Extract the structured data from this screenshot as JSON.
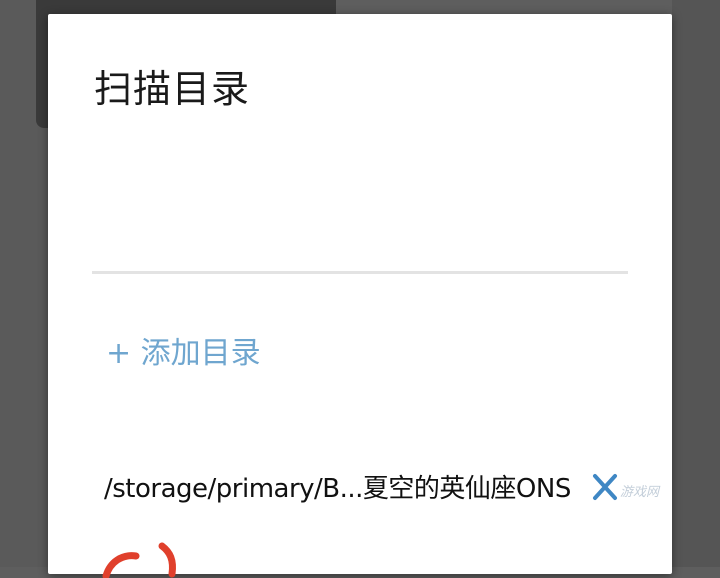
{
  "dialog": {
    "title": "扫描目录",
    "add_directory_label": "+ 添加目录",
    "directories": [
      {
        "path": "/storage/primary/B...夏空的英仙座ONS"
      }
    ]
  },
  "icons": {
    "remove": "close-x-icon"
  },
  "watermark": {
    "text": "游戏网"
  },
  "colors": {
    "accent": "#6fa6cf",
    "remove_icon": "#3f87c4",
    "title_text": "#1a1a1a",
    "divider": "#e3e3e3",
    "backdrop": "#5e5e5e",
    "annotation_red": "#e0402c"
  }
}
